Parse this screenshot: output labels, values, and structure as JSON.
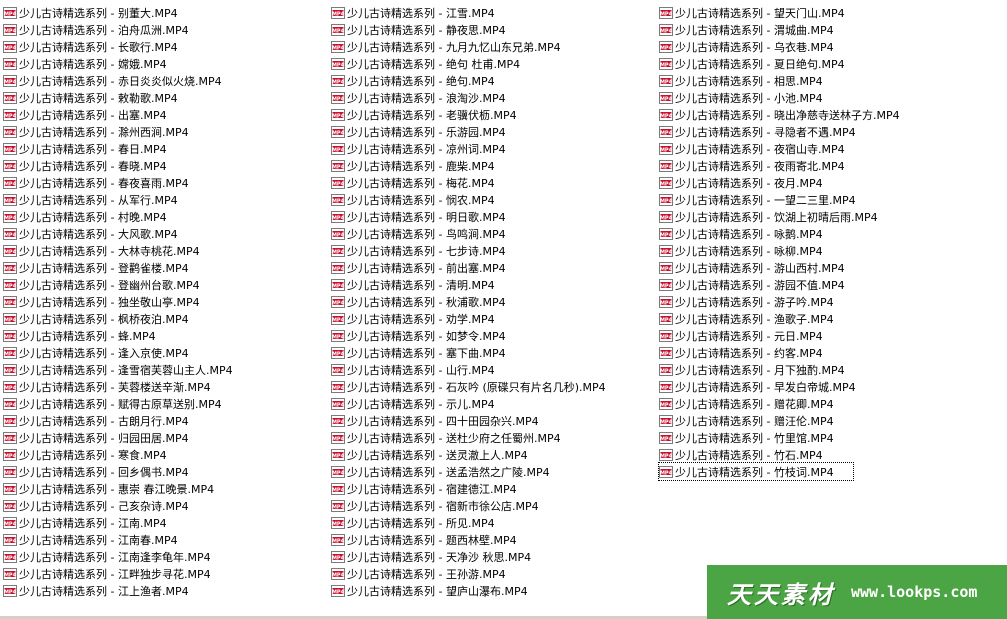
{
  "icon": "mp4-file-icon",
  "icon_text": "MP4",
  "colors": {
    "icon_red": "#c8102e",
    "watermark_green": "#4ca544"
  },
  "columns": [
    [
      "少儿古诗精选系列 - 别董大.MP4",
      "少儿古诗精选系列 - 泊舟瓜洲.MP4",
      "少儿古诗精选系列 - 长歌行.MP4",
      "少儿古诗精选系列 - 嫦娥.MP4",
      "少儿古诗精选系列 - 赤日炎炎似火烧.MP4",
      "少儿古诗精选系列 - 敕勒歌.MP4",
      "少儿古诗精选系列 - 出塞.MP4",
      "少儿古诗精选系列 - 滁州西涧.MP4",
      "少儿古诗精选系列 - 春日.MP4",
      "少儿古诗精选系列 - 春晓.MP4",
      "少儿古诗精选系列 - 春夜喜雨.MP4",
      "少儿古诗精选系列 - 从军行.MP4",
      "少儿古诗精选系列 - 村晚.MP4",
      "少儿古诗精选系列 - 大风歌.MP4",
      "少儿古诗精选系列 - 大林寺桃花.MP4",
      "少儿古诗精选系列 - 登鹳雀楼.MP4",
      "少儿古诗精选系列 - 登幽州台歌.MP4",
      "少儿古诗精选系列 - 独坐敬山亭.MP4",
      "少儿古诗精选系列 - 枫桥夜泊.MP4",
      "少儿古诗精选系列 - 蜂.MP4",
      "少儿古诗精选系列 - 逢入京使.MP4",
      "少儿古诗精选系列 - 逢雪宿芙蓉山主人.MP4",
      "少儿古诗精选系列 - 芙蓉楼送辛渐.MP4",
      "少儿古诗精选系列 - 赋得古原草送别.MP4",
      "少儿古诗精选系列 - 古朗月行.MP4",
      "少儿古诗精选系列 - 归园田居.MP4",
      "少儿古诗精选系列 - 寒食.MP4",
      "少儿古诗精选系列 - 回乡偶书.MP4",
      "少儿古诗精选系列 - 惠崇 春江晚景.MP4",
      "少儿古诗精选系列 - 己亥杂诗.MP4",
      "少儿古诗精选系列 - 江南.MP4",
      "少儿古诗精选系列 - 江南春.MP4",
      "少儿古诗精选系列 - 江南逢李龟年.MP4",
      "少儿古诗精选系列 - 江畔独步寻花.MP4",
      "少儿古诗精选系列 - 江上渔者.MP4"
    ],
    [
      "少儿古诗精选系列 - 江雪.MP4",
      "少儿古诗精选系列 - 静夜思.MP4",
      "少儿古诗精选系列 - 九月九忆山东兄弟.MP4",
      "少儿古诗精选系列 - 绝句 杜甫.MP4",
      "少儿古诗精选系列 - 绝句.MP4",
      "少儿古诗精选系列 - 浪淘沙.MP4",
      "少儿古诗精选系列 - 老骥伏枥.MP4",
      "少儿古诗精选系列 - 乐游园.MP4",
      "少儿古诗精选系列 - 凉州词.MP4",
      "少儿古诗精选系列 - 鹿柴.MP4",
      "少儿古诗精选系列 - 梅花.MP4",
      "少儿古诗精选系列 - 悯农.MP4",
      "少儿古诗精选系列 - 明日歌.MP4",
      "少儿古诗精选系列 - 鸟鸣涧.MP4",
      "少儿古诗精选系列 - 七步诗.MP4",
      "少儿古诗精选系列 - 前出塞.MP4",
      "少儿古诗精选系列 - 清明.MP4",
      "少儿古诗精选系列 - 秋浦歌.MP4",
      "少儿古诗精选系列 - 劝学.MP4",
      "少儿古诗精选系列 - 如梦令.MP4",
      "少儿古诗精选系列 - 塞下曲.MP4",
      "少儿古诗精选系列 - 山行.MP4",
      "少儿古诗精选系列 - 石灰吟 (原碟只有片名几秒).MP4",
      "少儿古诗精选系列 - 示儿.MP4",
      "少儿古诗精选系列 - 四十田园杂兴.MP4",
      "少儿古诗精选系列 - 送杜少府之任蜀州.MP4",
      "少儿古诗精选系列 - 送灵澈上人.MP4",
      "少儿古诗精选系列 - 送孟浩然之广陵.MP4",
      "少儿古诗精选系列 - 宿建德江.MP4",
      "少儿古诗精选系列 - 宿新市徐公店.MP4",
      "少儿古诗精选系列 - 所见.MP4",
      "少儿古诗精选系列 - 题西林壁.MP4",
      "少儿古诗精选系列 - 天净沙 秋思.MP4",
      "少儿古诗精选系列 - 王孙游.MP4",
      "少儿古诗精选系列 - 望庐山瀑布.MP4"
    ],
    [
      "少儿古诗精选系列 - 望天门山.MP4",
      "少儿古诗精选系列 - 渭城曲.MP4",
      "少儿古诗精选系列 - 乌衣巷.MP4",
      "少儿古诗精选系列 - 夏日绝句.MP4",
      "少儿古诗精选系列 - 相思.MP4",
      "少儿古诗精选系列 - 小池.MP4",
      "少儿古诗精选系列 - 晓出净慈寺送林子方.MP4",
      "少儿古诗精选系列 - 寻隐者不遇.MP4",
      "少儿古诗精选系列 - 夜宿山寺.MP4",
      "少儿古诗精选系列 - 夜雨寄北.MP4",
      "少儿古诗精选系列 - 夜月.MP4",
      "少儿古诗精选系列 - 一望二三里.MP4",
      "少儿古诗精选系列 - 饮湖上初晴后雨.MP4",
      "少儿古诗精选系列 - 咏鹅.MP4",
      "少儿古诗精选系列 - 咏柳.MP4",
      "少儿古诗精选系列 - 游山西村.MP4",
      "少儿古诗精选系列 - 游园不值.MP4",
      "少儿古诗精选系列 - 游子吟.MP4",
      "少儿古诗精选系列 - 渔歌子.MP4",
      "少儿古诗精选系列 - 元日.MP4",
      "少儿古诗精选系列 - 约客.MP4",
      "少儿古诗精选系列 - 月下独酌.MP4",
      "少儿古诗精选系列 - 早发白帝城.MP4",
      "少儿古诗精选系列 - 赠花卿.MP4",
      "少儿古诗精选系列 - 赠汪伦.MP4",
      "少儿古诗精选系列 - 竹里馆.MP4",
      "少儿古诗精选系列 - 竹石.MP4",
      "少儿古诗精选系列 - 竹枝词.MP4"
    ]
  ],
  "focused_item": {
    "column": 2,
    "index": 27
  },
  "watermark": {
    "brand": "天天素材",
    "url": "www.lookps.com"
  }
}
